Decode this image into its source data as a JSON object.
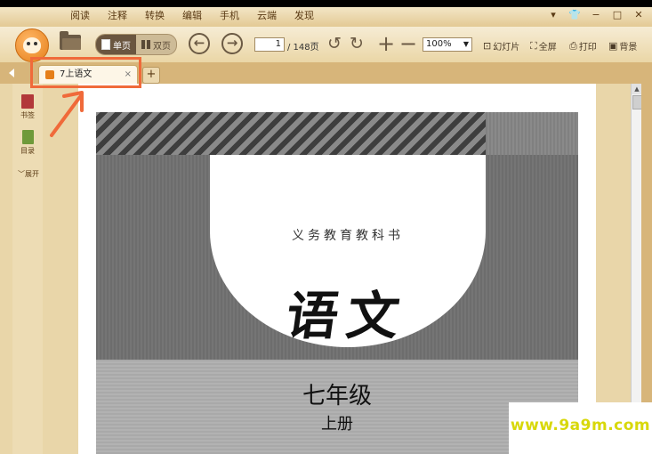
{
  "menu": {
    "tabs": [
      "阅读",
      "注释",
      "转换",
      "编辑",
      "手机",
      "云端",
      "发现"
    ]
  },
  "window_controls": [
    "▾",
    "👕",
    "−",
    "□",
    "✕"
  ],
  "toolbar": {
    "single_page_label": "单页",
    "double_page_label": "双页",
    "page_current": "1",
    "page_total": "/ 148页",
    "zoom": "100%",
    "slideshow_label": "幻灯片",
    "fullscreen_label": "全屏",
    "print_label": "打印",
    "background_label": "背景"
  },
  "document_tab": {
    "label": "7上语文",
    "close": "×",
    "add": "+"
  },
  "sidebar": {
    "bookmark_label": "书签",
    "toc_label": "目录",
    "expand_label": "展开"
  },
  "cover": {
    "subtitle": "义务教育教科书",
    "title": "语文",
    "grade": "七年级",
    "volume": "上册"
  },
  "watermark": "www.9a9m.com",
  "colors": {
    "highlight": "#f06a3a",
    "accent": "#e57f1a",
    "chrome": "#e9d6a9"
  }
}
